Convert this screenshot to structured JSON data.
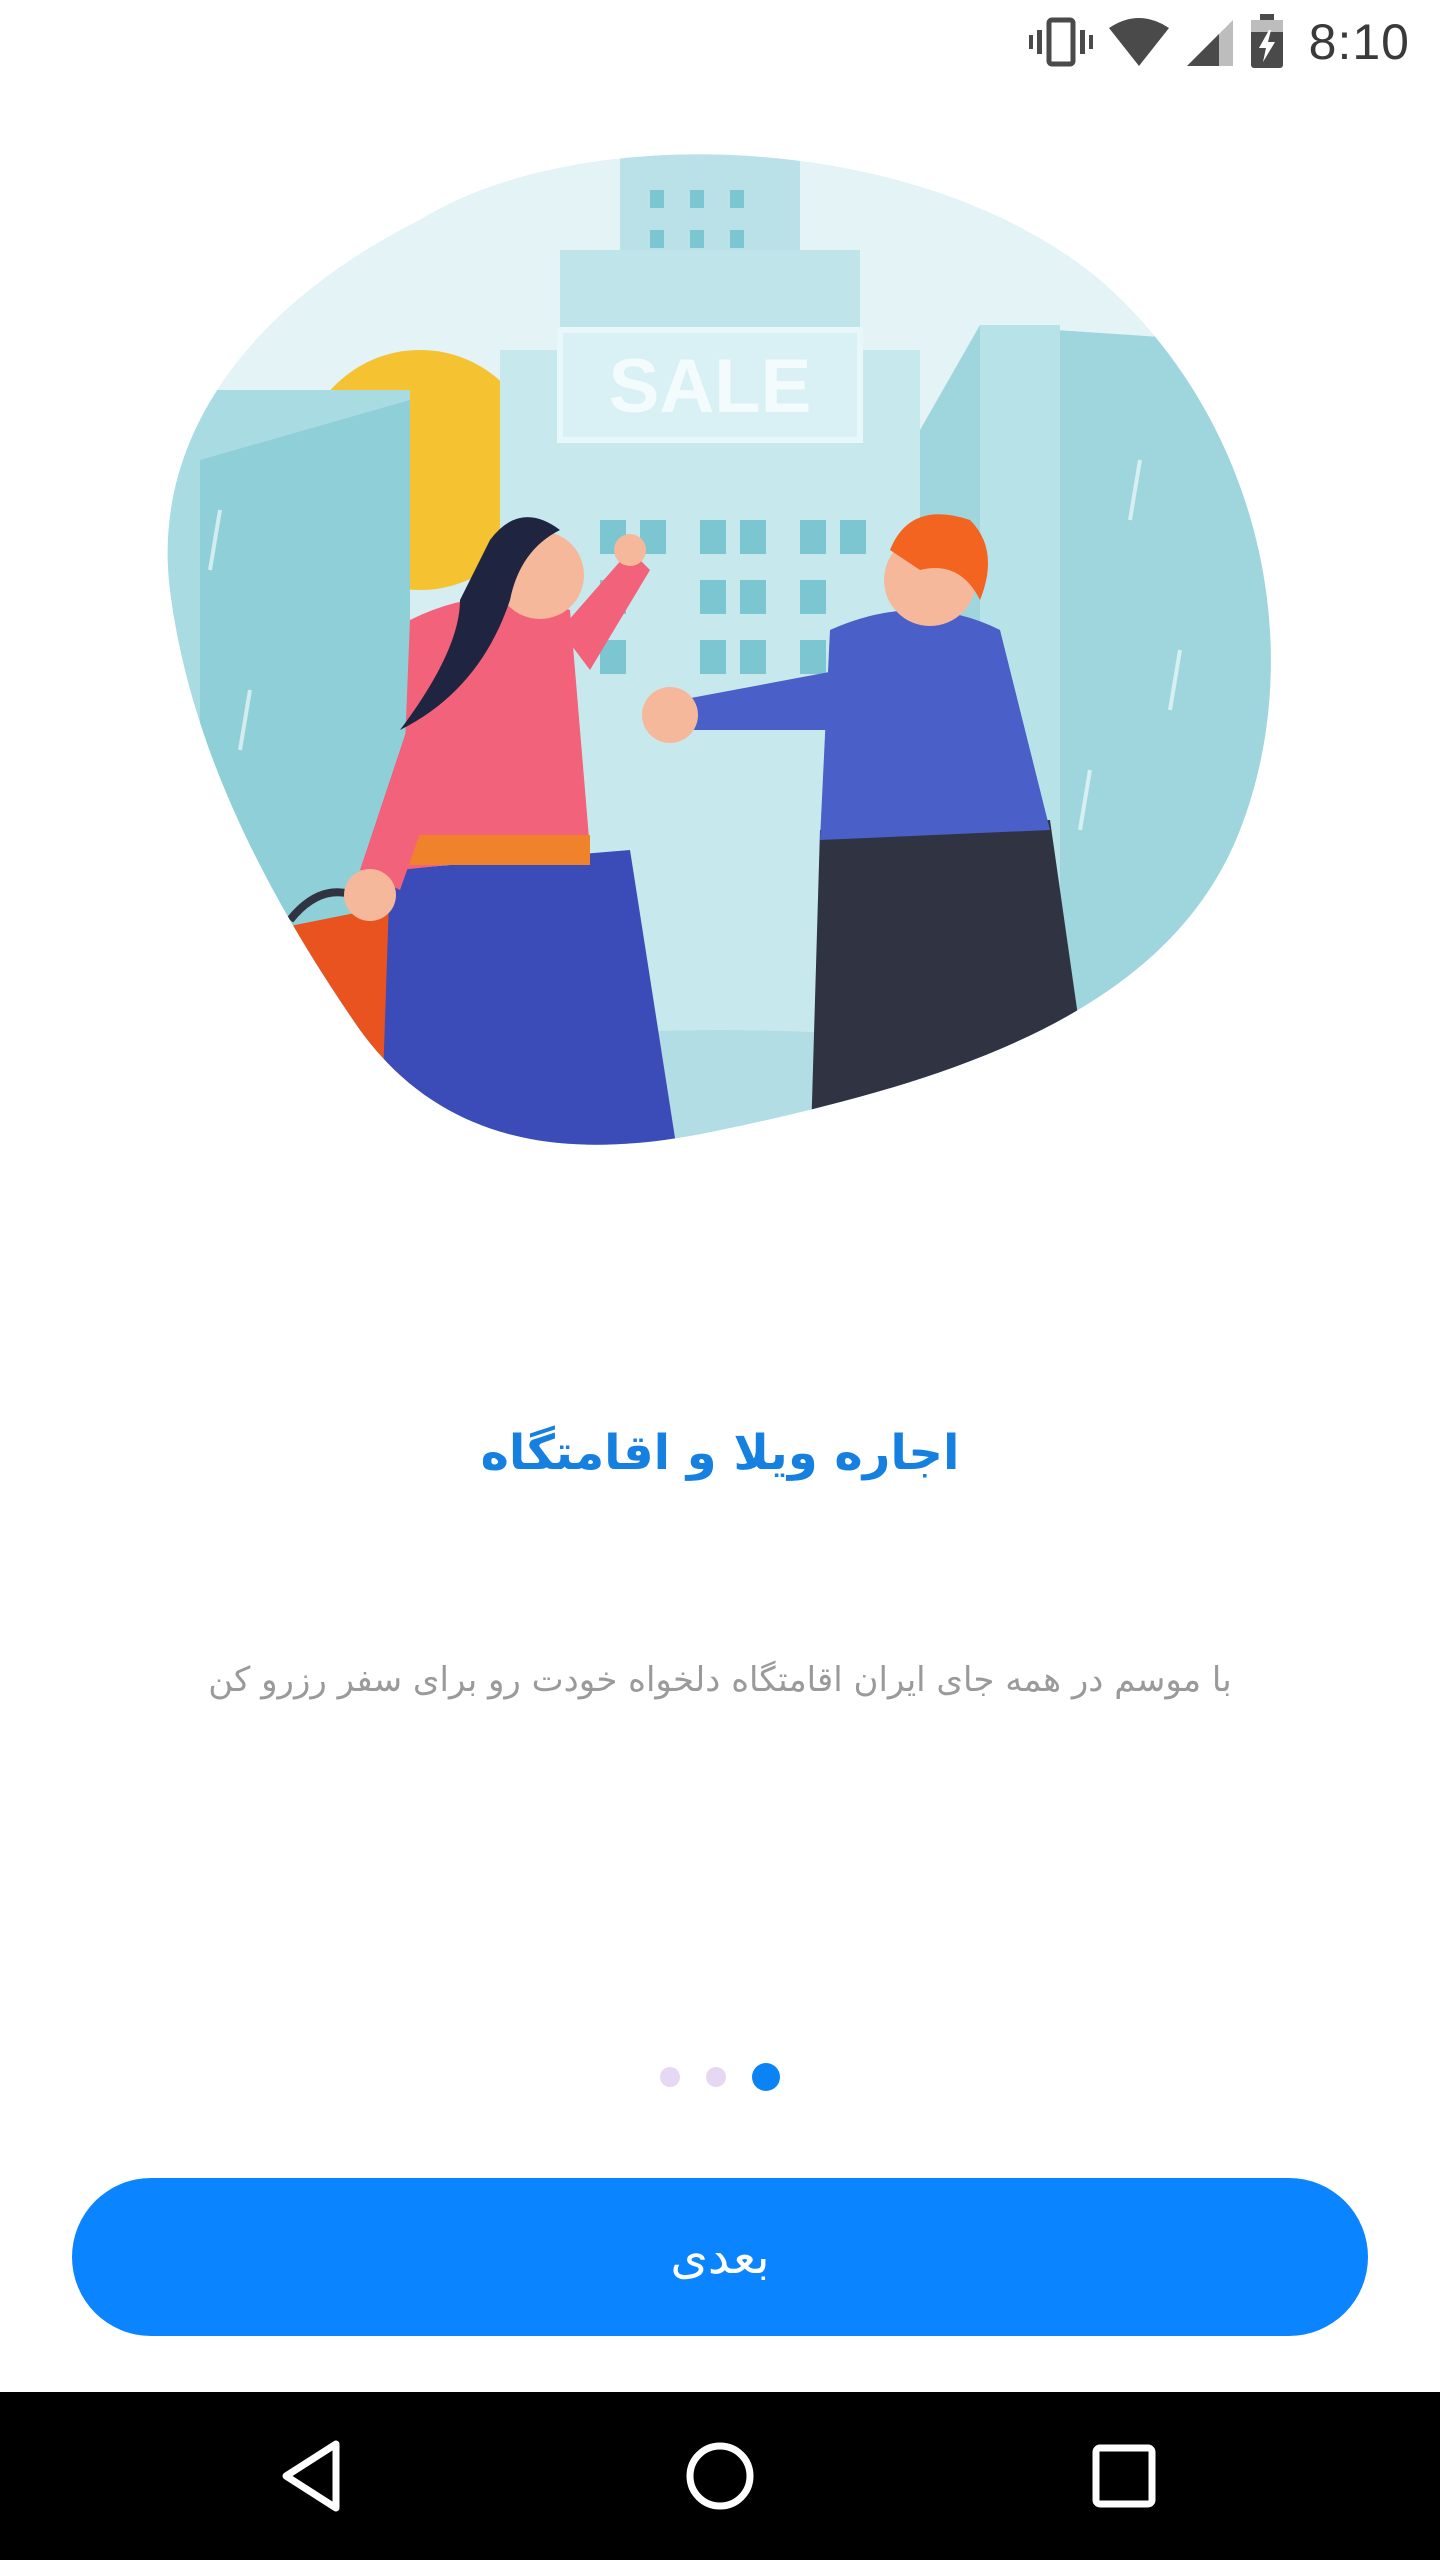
{
  "status_bar": {
    "time": "8:10",
    "icons": [
      "vibrate-icon",
      "wifi-icon",
      "signal-icon",
      "battery-charging-icon"
    ]
  },
  "illustration": {
    "sign_text": "SALE",
    "icon": "couple-shopping-illustration"
  },
  "onboarding": {
    "title": "اجاره ویلا و اقامتگاه",
    "subtitle": "با موسم در همه جای ایران اقامتگاه دلخواه خودت رو برای سفر رزرو کن",
    "page_index": 1,
    "page_count": 3
  },
  "next_button": {
    "label": "بعدی"
  },
  "nav_bar": {
    "icons": [
      "back-icon",
      "home-icon",
      "recents-icon"
    ]
  },
  "colors": {
    "accent": "#0a84ff",
    "title": "#1580e0",
    "subtitle": "#9a9a9a",
    "dot_active": "#0a84f4",
    "dot_inactive": "#e6d8f2"
  }
}
